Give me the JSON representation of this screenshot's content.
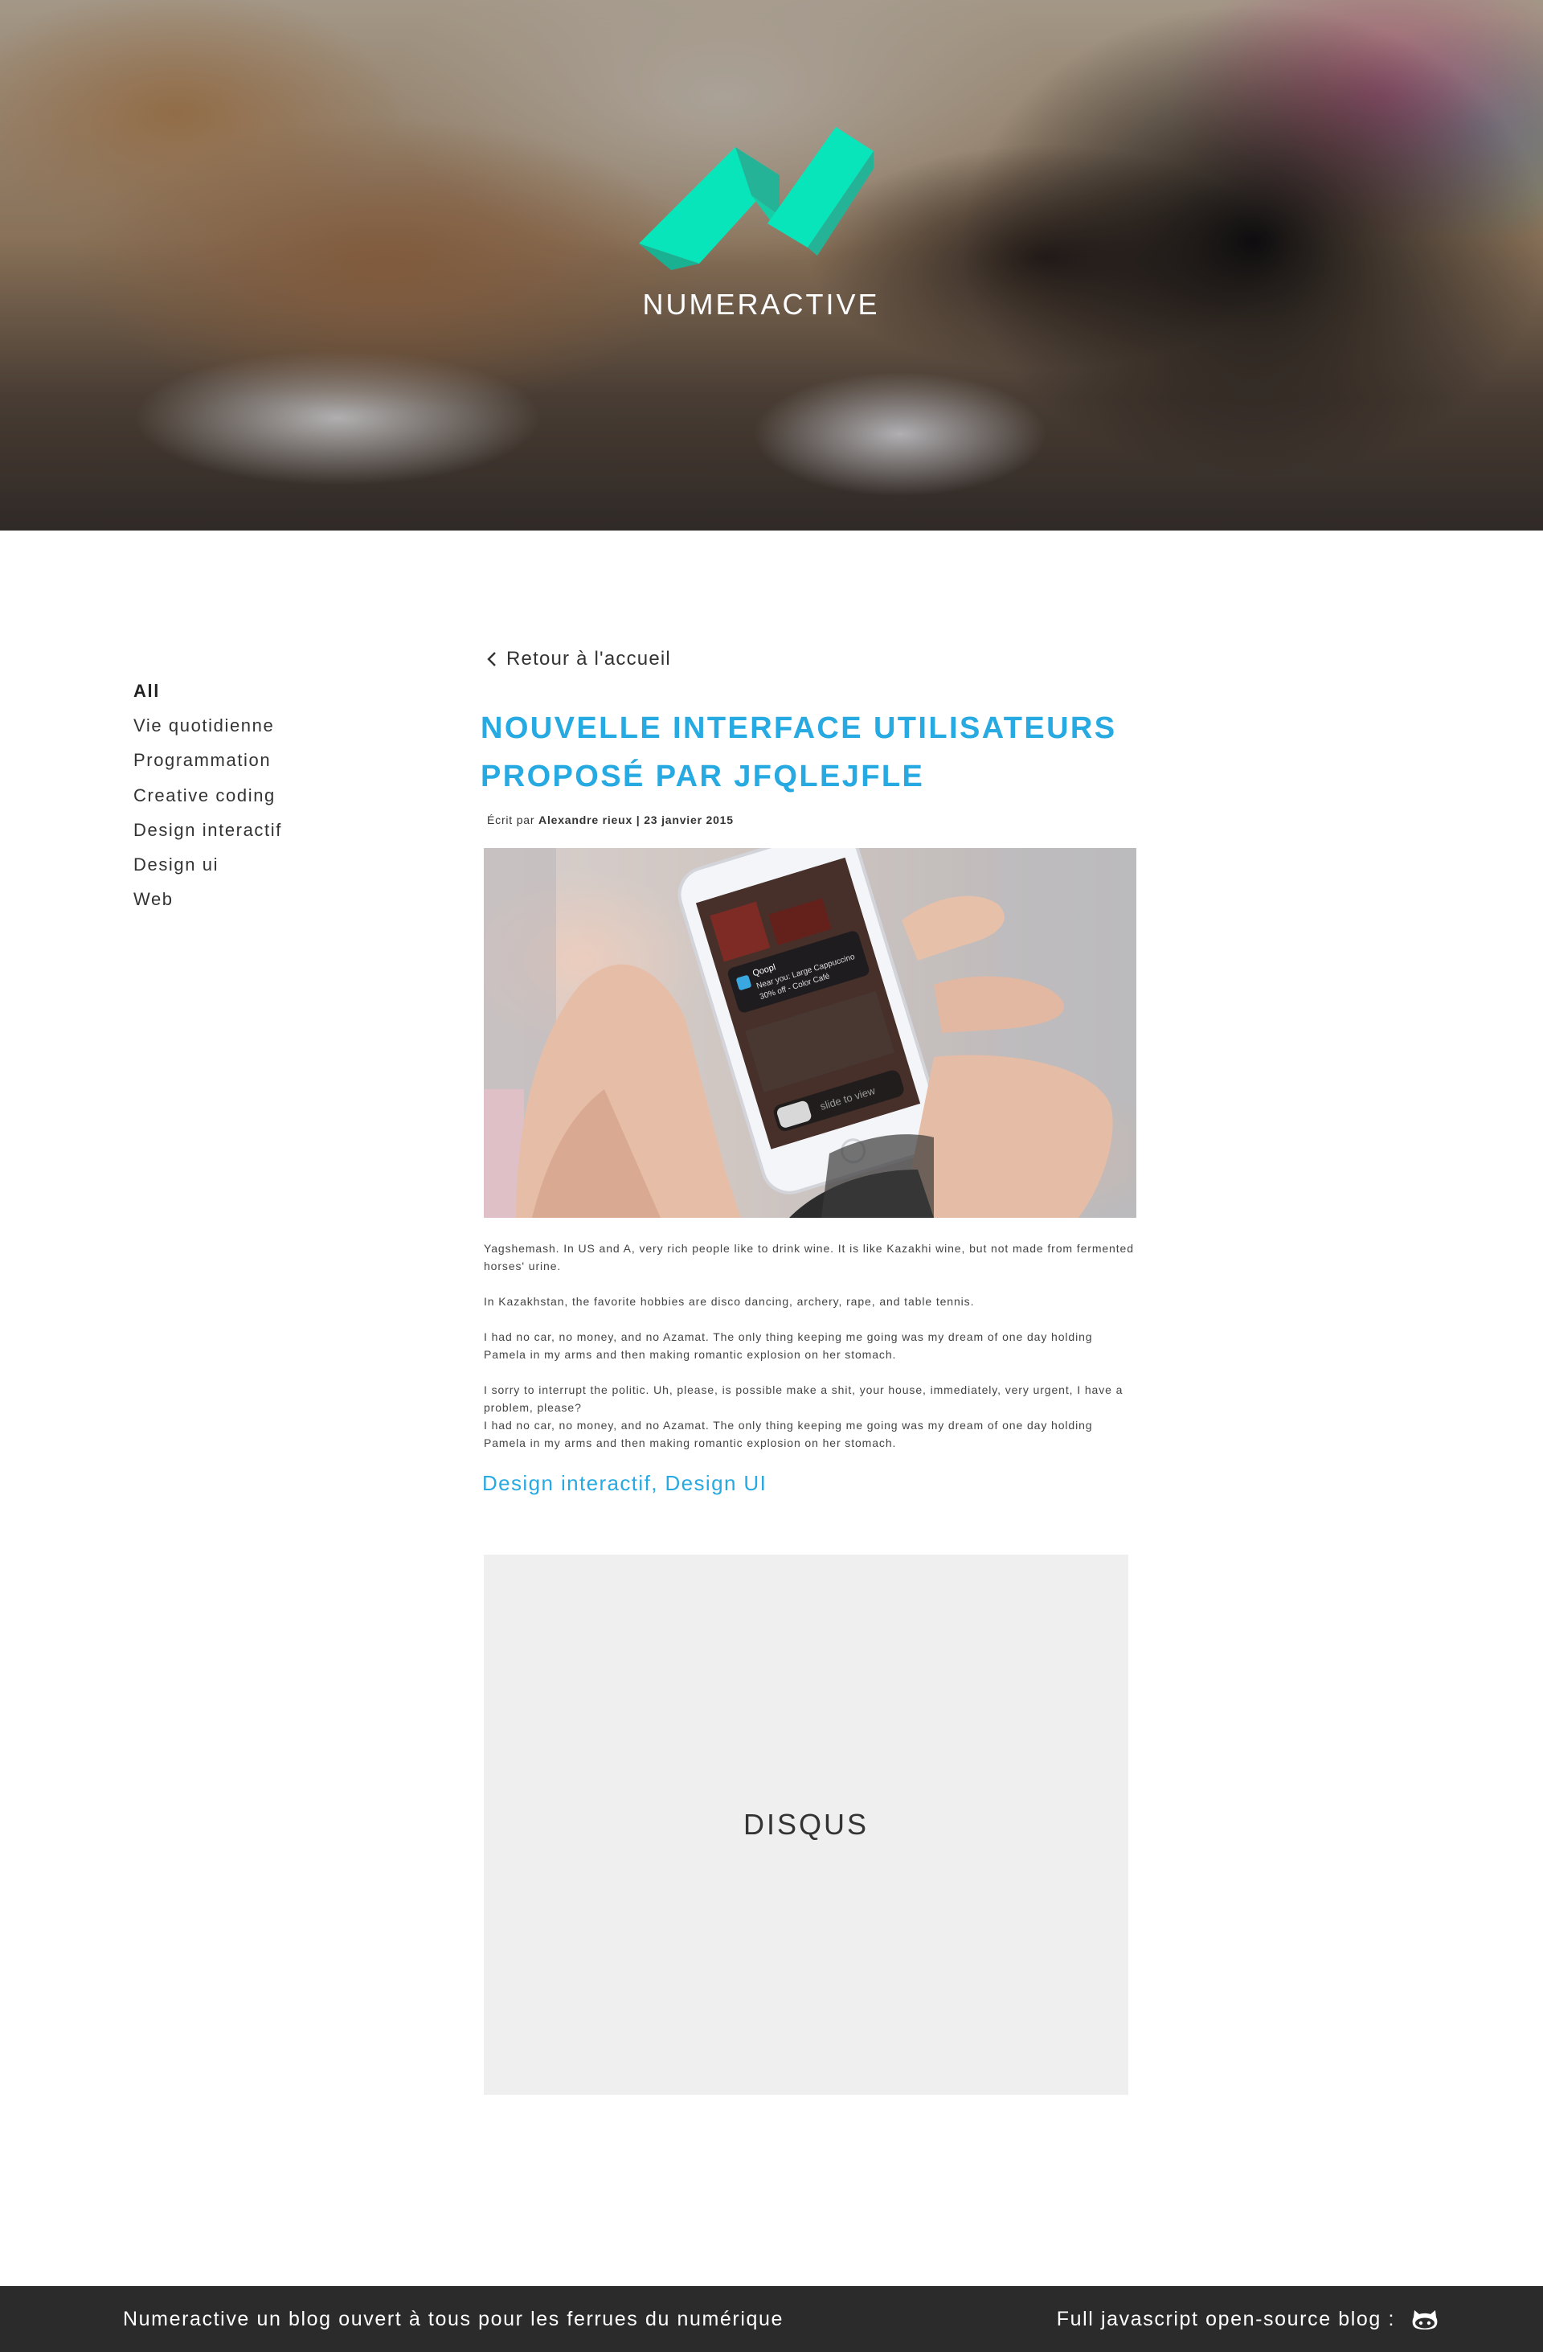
{
  "header": {
    "site_name": "NUMERACTIVE",
    "logo_color": "#00e8bb",
    "logo_shade_color": "#1fb597"
  },
  "sidebar": {
    "items": [
      {
        "label": "All",
        "active": true
      },
      {
        "label": "Vie quotidienne",
        "active": false
      },
      {
        "label": "Programmation",
        "active": false
      },
      {
        "label": "Creative coding",
        "active": false
      },
      {
        "label": "Design interactif",
        "active": false
      },
      {
        "label": "Design ui",
        "active": false
      },
      {
        "label": "Web",
        "active": false
      }
    ]
  },
  "article": {
    "back_label": "Retour à l'accueil",
    "back_icon": "chevron-left-icon",
    "title_line1": "NOUVELLE INTERFACE UTILISATEURS",
    "title_line2": "PROPOSÉ PAR JFQLEJFLE",
    "title_color": "#27a9e1",
    "byline_prefix": "Écrit par",
    "author": "Alexandre rieux",
    "separator": "|",
    "date": "23 janvier 2015",
    "image": {
      "notification_app": "Qoopl",
      "notification_line1": "Near you: Large Cappuccino",
      "notification_line2": "30% off - Color Café",
      "slider_text": "slide to view"
    },
    "paragraphs": [
      "Yagshemash. In US and A, very rich people like to drink wine. It is like Kazakhi wine, but not made from fermented horses' urine.",
      "In Kazakhstan, the favorite hobbies are disco dancing, archery, rape, and table tennis.",
      "I had no car, no money, and no Azamat. The only thing keeping me going was my dream of one day holding Pamela in my arms and then making romantic explosion on her stomach.",
      "I sorry to interrupt the politic. Uh, please, is possible make a shit, your house, immediately, very urgent, I have a problem, please?",
      "I had no car, no money, and no Azamat. The only thing keeping me going was my dream of one day holding Pamela in my arms and then making romantic explosion on her stomach."
    ],
    "tags": "Design interactif, Design UI"
  },
  "comments": {
    "placeholder_label": "DISQUS"
  },
  "footer": {
    "left_text": "Numeractive un blog ouvert à tous pour les ferrues du numérique",
    "right_text": "Full javascript open-source blog :",
    "icon": "github-icon"
  }
}
